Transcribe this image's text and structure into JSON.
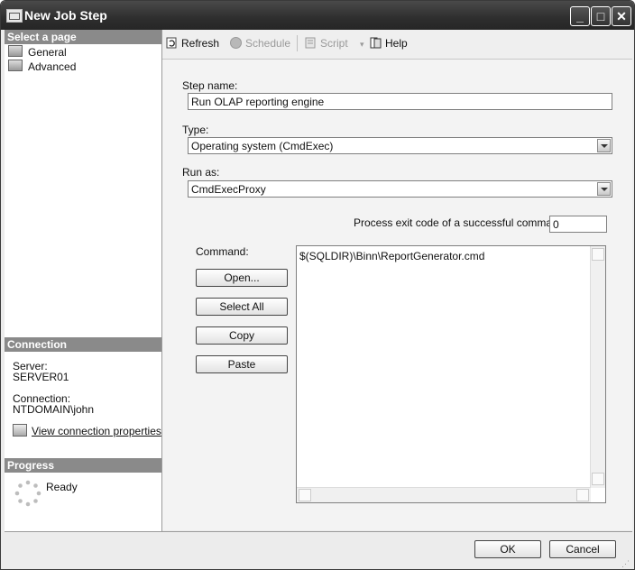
{
  "window": {
    "title": "New Job Step",
    "controls": {
      "minimize": "_",
      "maximize": "□",
      "close": "✕"
    }
  },
  "left_pane": {
    "select_page_header": "Select a page",
    "pages": [
      {
        "label": "General",
        "icon": "page-icon"
      },
      {
        "label": "Advanced",
        "icon": "page-icon"
      }
    ],
    "connection_header": "Connection",
    "server_label": "Server:",
    "server_value": "SERVER01",
    "connection_label": "Connection:",
    "connection_value": "NTDOMAIN\\john",
    "view_link": "View connection properties",
    "progress_header": "Progress",
    "progress_status": "Ready"
  },
  "toolbar": {
    "refresh": "Refresh",
    "schedule": "Schedule",
    "script": "Script",
    "help": "Help"
  },
  "form": {
    "step_name_label": "Step name:",
    "step_name_value": "Run OLAP reporting engine",
    "type_label": "Type:",
    "type_value": "Operating system (CmdExec)",
    "run_as_label": "Run as:",
    "run_as_value": "CmdExecProxy",
    "exit_code_label": "Process exit code of a successful command:",
    "exit_code_value": "0",
    "command_label": "Command:",
    "command_value": "$(SQLDIR)\\Binn\\ReportGenerator.cmd",
    "buttons": {
      "open": "Open...",
      "select_all": "Select All",
      "copy": "Copy",
      "paste": "Paste"
    }
  },
  "footer": {
    "ok": "OK",
    "cancel": "Cancel"
  }
}
